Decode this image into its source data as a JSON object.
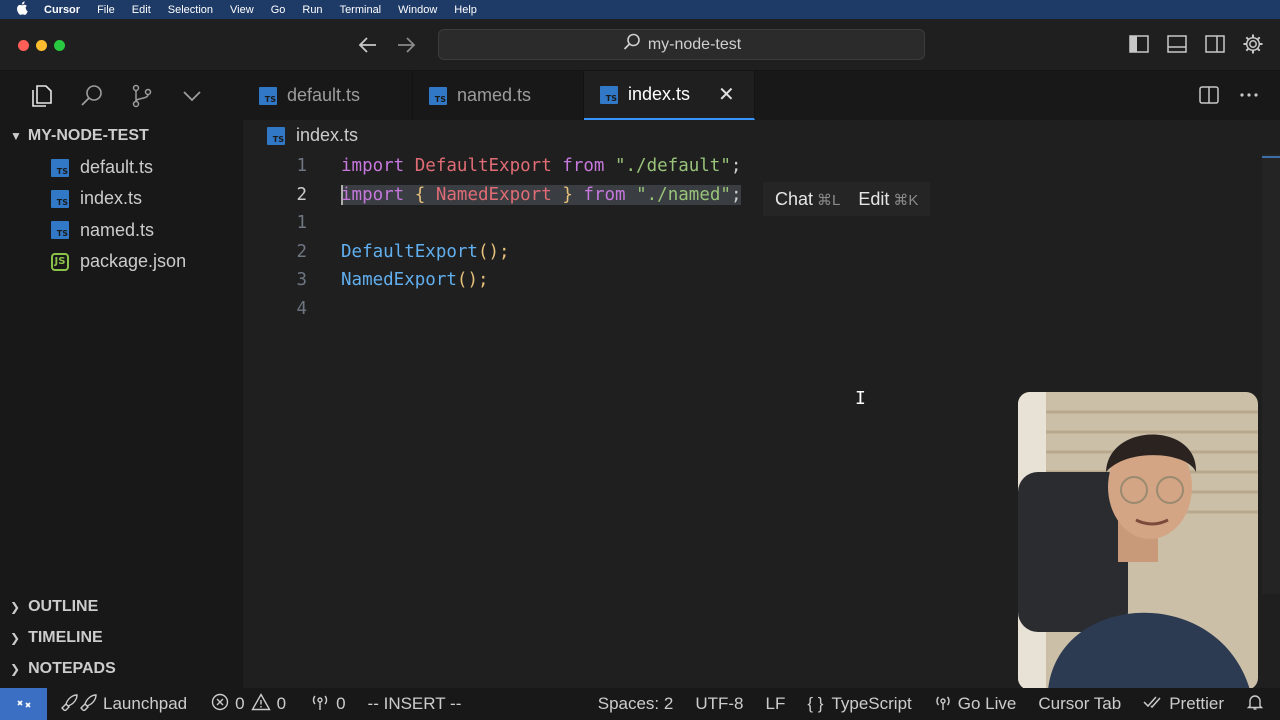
{
  "menubar": {
    "app": "Cursor",
    "items": [
      "File",
      "Edit",
      "Selection",
      "View",
      "Go",
      "Run",
      "Terminal",
      "Window",
      "Help"
    ]
  },
  "titlebar": {
    "search_text": "my-node-test"
  },
  "tabs": [
    {
      "label": "default.ts",
      "active": false
    },
    {
      "label": "named.ts",
      "active": false
    },
    {
      "label": "index.ts",
      "active": true
    }
  ],
  "sidebar": {
    "root": "MY-NODE-TEST",
    "files": [
      {
        "name": "default.ts",
        "icon": "ts"
      },
      {
        "name": "index.ts",
        "icon": "ts"
      },
      {
        "name": "named.ts",
        "icon": "ts"
      },
      {
        "name": "package.json",
        "icon": "js"
      }
    ],
    "sections": [
      "OUTLINE",
      "TIMELINE",
      "NOTEPADS"
    ]
  },
  "editor": {
    "breadcrumb": "index.ts",
    "line_numbers": [
      "1",
      "2",
      "1",
      "2",
      "3",
      "4"
    ],
    "code": {
      "l1_kw1": "import",
      "l1_id": "DefaultExport",
      "l1_kw2": "from",
      "l1_str": "\"./default\"",
      "l1_semi": ";",
      "l2_kw1": "import",
      "l2_open": "{",
      "l2_id": "NamedExport",
      "l2_close": "}",
      "l2_kw2": "from",
      "l2_str": "\"./named\"",
      "l2_semi": ";",
      "l4_fn": "DefaultExport",
      "l4_rest": "();",
      "l5_fn": "NamedExport",
      "l5_rest": "();"
    },
    "hint": {
      "chat": "Chat",
      "chat_kbd": "⌘L",
      "edit": "Edit",
      "edit_kbd": "⌘K"
    }
  },
  "statusbar": {
    "launchpad": "Launchpad",
    "errors": "0",
    "warnings": "0",
    "ports": "0",
    "mode": "-- INSERT --",
    "spaces": "Spaces: 2",
    "encoding": "UTF-8",
    "eol": "LF",
    "language": "TypeScript",
    "golive": "Go Live",
    "cursor_tab": "Cursor Tab",
    "prettier": "Prettier"
  },
  "colors": {
    "accent": "#3794ff",
    "keyword": "#c678dd",
    "identifier": "#e06c75",
    "function": "#61afef",
    "string": "#98c379"
  }
}
